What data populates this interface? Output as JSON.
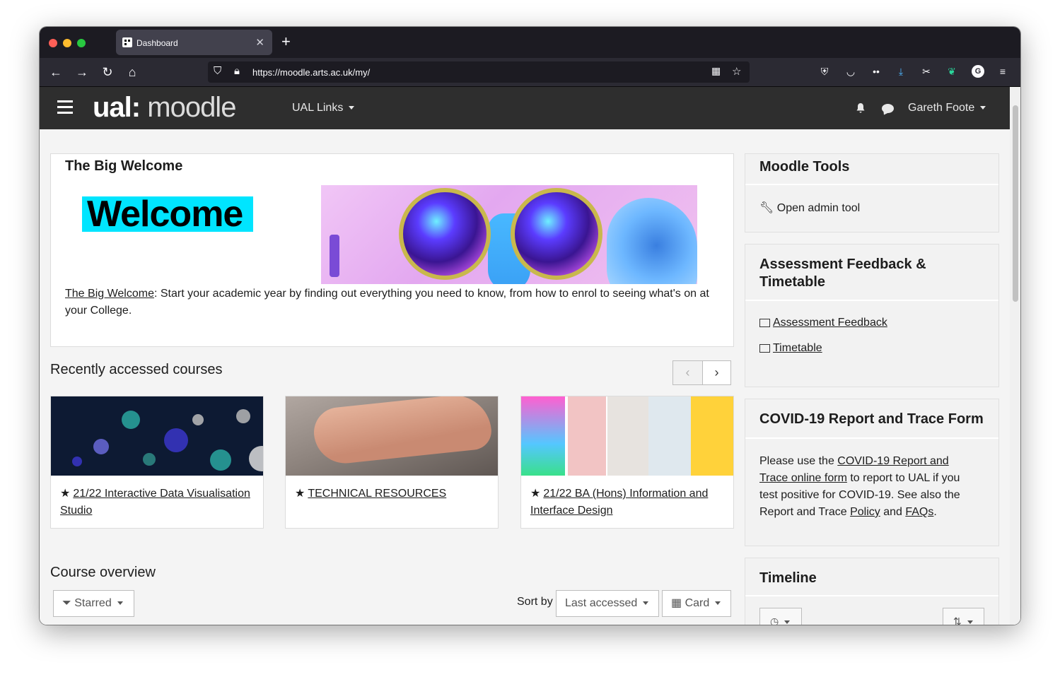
{
  "browser": {
    "tab_title": "Dashboard",
    "url": "https://moodle.arts.ac.uk/my/"
  },
  "header": {
    "logo_prefix": "ual:",
    "logo_suffix": "moodle",
    "ual_links": "UAL Links",
    "user_name": "Gareth Foote"
  },
  "welcome": {
    "heading": "The Big Welcome",
    "banner_word": "Welcome",
    "link_text": "The Big Welcome",
    "body_text": ": Start your academic year by finding out everything you need to know, from how to enrol to seeing what's on at your College."
  },
  "recent": {
    "heading": "Recently accessed courses",
    "prev_icon": "‹",
    "next_icon": "›",
    "courses": [
      {
        "name": "21/22 Interactive Data Visualisation Studio"
      },
      {
        "name": "TECHNICAL RESOURCES"
      },
      {
        "name": "21/22 BA (Hons) Information and Interface Design"
      }
    ]
  },
  "overview": {
    "heading": "Course overview",
    "filter_label": "Starred",
    "sort_by": "Sort by",
    "sort_value": "Last accessed",
    "view_value": "Card"
  },
  "blocks": {
    "moodle_tools": {
      "title": "Moodle Tools",
      "item": "Open admin tool"
    },
    "assessment": {
      "title": "Assessment Feedback & Timetable",
      "link1": "Assessment Feedback",
      "link2": "Timetable"
    },
    "covid": {
      "title": "COVID-19 Report and Trace Form",
      "t1": "Please use the ",
      "link1": "COVID-19 Report and Trace online form",
      "t2": " to report to UAL if you test positive for COVID-19. See also the Report and Trace ",
      "link2": "Policy",
      "t3": " and ",
      "link3": "FAQs",
      "t4": "."
    },
    "timeline": {
      "title": "Timeline"
    }
  }
}
